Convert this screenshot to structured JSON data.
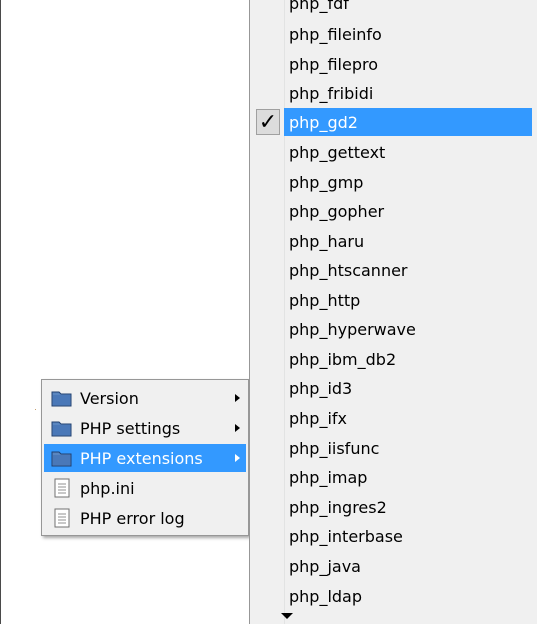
{
  "context_menu": {
    "items": [
      {
        "label": "Version",
        "icon": "folder-icon",
        "has_submenu": true
      },
      {
        "label": "PHP settings",
        "icon": "folder-icon",
        "has_submenu": true
      },
      {
        "label": "PHP extensions",
        "icon": "folder-icon",
        "has_submenu": true,
        "highlighted": true
      },
      {
        "label": "php.ini",
        "icon": "document-icon",
        "has_submenu": false
      },
      {
        "label": "PHP error log",
        "icon": "document-icon",
        "has_submenu": false
      }
    ]
  },
  "extensions_menu": {
    "items": [
      {
        "label": "php_fdf"
      },
      {
        "label": "php_fileinfo"
      },
      {
        "label": "php_filepro"
      },
      {
        "label": "php_fribidi"
      },
      {
        "label": "php_gd2",
        "checked": true,
        "highlighted": true
      },
      {
        "label": "php_gettext"
      },
      {
        "label": "php_gmp"
      },
      {
        "label": "php_gopher"
      },
      {
        "label": "php_haru"
      },
      {
        "label": "php_htscanner"
      },
      {
        "label": "php_http"
      },
      {
        "label": "php_hyperwave"
      },
      {
        "label": "php_ibm_db2"
      },
      {
        "label": "php_id3"
      },
      {
        "label": "php_ifx"
      },
      {
        "label": "php_iisfunc"
      },
      {
        "label": "php_imap"
      },
      {
        "label": "php_ingres2"
      },
      {
        "label": "php_interbase"
      },
      {
        "label": "php_java"
      },
      {
        "label": "php_ldap"
      }
    ],
    "checkmark": "✓",
    "scroll_icon": "scroll-down-arrow-icon"
  },
  "colors": {
    "highlight": "#3399ff",
    "menu_bg": "#f0f0f0"
  }
}
